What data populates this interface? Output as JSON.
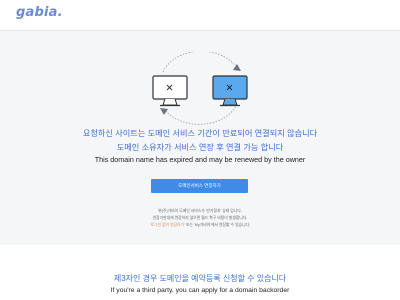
{
  "header": {
    "logo": "gabia."
  },
  "main": {
    "message_ko_line1": "요청하신 사이트는 도메인 서비스 기간이 만료되어 연결되지 않습니다",
    "message_ko_line2": "도메인 소유자가 서비스 연장 후 연결 가능 합니다",
    "message_en": "This domain name has expired and may be renewed by the owner",
    "renew_button_label": "도메인서비스 연장하기",
    "notice_line1": "위(주)가비아 도메인 서비스가 '만기정지' 상태 입니다.",
    "notice_line2": "연장기한내에 연장하지 않으면 월드 복구 비용이 발생합니다.",
    "notice_line3_link": "'로그인 없이 연장하기'",
    "notice_line3_rest": "또는 'My가비아'에서 연장할 수 있습니다."
  },
  "footer": {
    "message_ko": "제3자인 경우 도메인을 예약등록 신청할 수 있습니다",
    "message_en": "If you're a third party, you can apply for a domain backorder"
  },
  "colors": {
    "accent_blue": "#3d6fcf",
    "button_blue": "#3f8be8",
    "logo_blue": "#6d8bd0",
    "background": "#f5f6f8",
    "link_orange": "#d88a5c"
  },
  "icons": [
    "disconnected-monitor-icon",
    "connected-monitor-icon",
    "close-mark-icon",
    "refresh-arrows-icon"
  ]
}
